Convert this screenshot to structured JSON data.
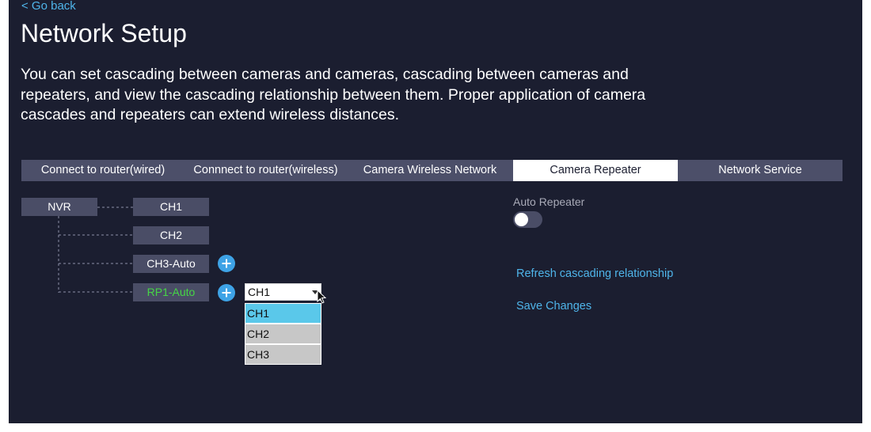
{
  "nav": {
    "back_label": "< Go back"
  },
  "header": {
    "title": "Network Setup",
    "description": "You can set cascading between cameras and cameras, cascading between cameras and repeaters, and view the cascading relationship between them. Proper application of camera cascades and repeaters can extend wireless distances."
  },
  "tabs": [
    {
      "label": "Connect to router(wired)",
      "active": false
    },
    {
      "label": "Connnect to router(wireless)",
      "active": false
    },
    {
      "label": "Camera Wireless Network",
      "active": false
    },
    {
      "label": "Camera Repeater",
      "active": true
    },
    {
      "label": "Network Service",
      "active": false
    }
  ],
  "tree": {
    "root": "NVR",
    "nodes": [
      {
        "label": "CH1"
      },
      {
        "label": "CH2"
      },
      {
        "label": "CH3-Auto"
      },
      {
        "label": "RP1-Auto"
      }
    ]
  },
  "icons": {
    "add": "plus-circle-icon",
    "cursor": "mouse-pointer-icon"
  },
  "dropdown": {
    "value": "CH1",
    "options": [
      "CH1",
      "CH2",
      "CH3"
    ],
    "highlighted": "CH1"
  },
  "repeater": {
    "auto_label": "Auto Repeater",
    "auto_enabled": false,
    "refresh_label": "Refresh cascading relationship",
    "save_label": "Save Changes"
  },
  "colors": {
    "background": "#1b1e30",
    "accent": "#4fb5ea",
    "tab_bar": "#4c4f69",
    "node": "#4a4d66",
    "repeater_text": "#46d646",
    "option_selected": "#5ac8ea",
    "option": "#c7c7c7"
  }
}
